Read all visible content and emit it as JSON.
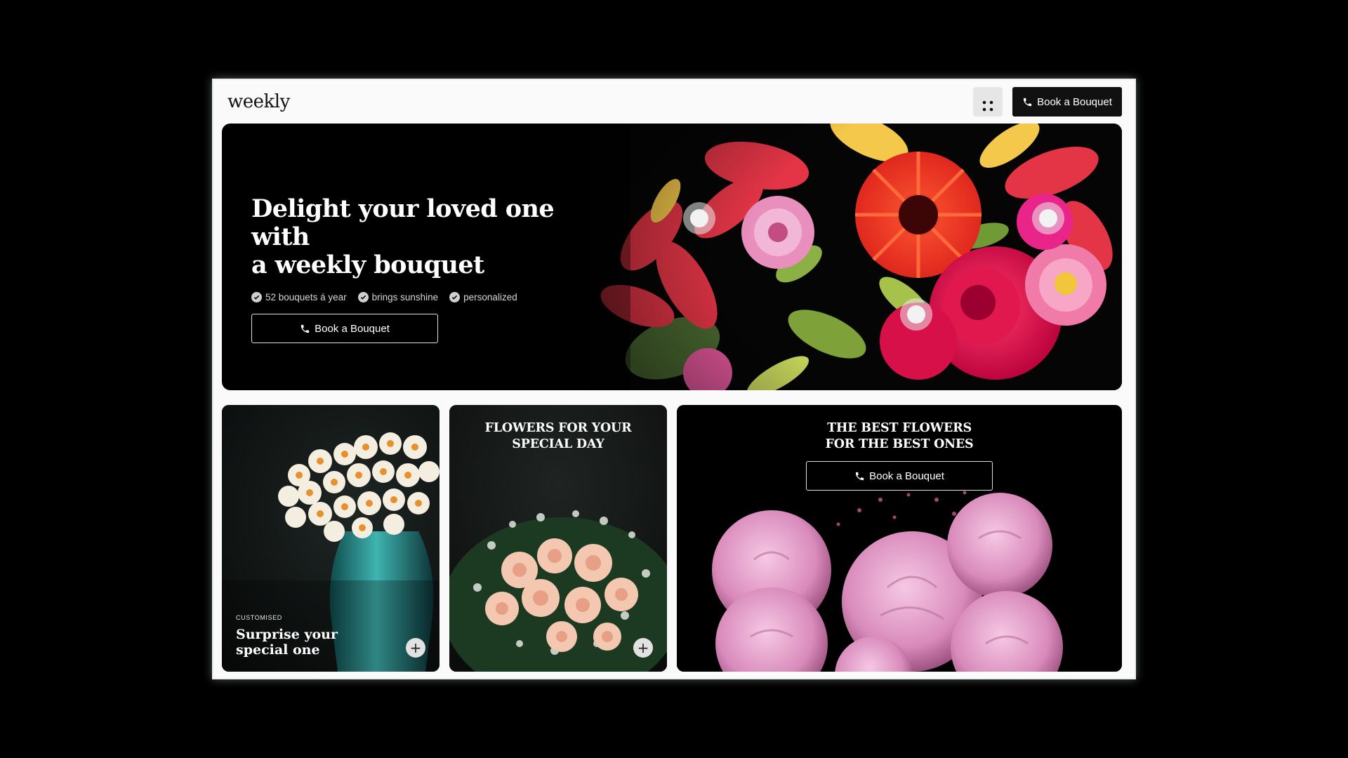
{
  "header": {
    "logo": "weekly",
    "menu_icon": "grid-icon",
    "cta_label": "Book a Bouquet",
    "cta_icon": "phone-icon"
  },
  "hero": {
    "title_line1": "Delight your loved one with",
    "title_line2": "a weekly bouquet",
    "features": [
      "52 bouquets á year",
      "brings sunshine",
      "personalized"
    ],
    "feature_icon": "check-circle-icon",
    "cta_label": "Book a Bouquet",
    "hotspot_count": 3
  },
  "cards": [
    {
      "kicker": "CUSTOMISED",
      "title_line1": "Surprise your",
      "title_line2": "special one",
      "action_icon": "plus-icon"
    },
    {
      "heading_line1": "FLOWERS FOR YOUR",
      "heading_line2": "SPECIAL DAY",
      "action_icon": "plus-icon"
    },
    {
      "heading_line1": "THE BEST FLOWERS",
      "heading_line2": "FOR THE BEST ONES",
      "cta_label": "Book a Bouquet"
    }
  ],
  "colors": {
    "page_background": "#000000",
    "frame_background": "#fafafa",
    "primary_button": "#111111",
    "accent_red": "#e0303e",
    "accent_pink": "#e7a3c9"
  }
}
